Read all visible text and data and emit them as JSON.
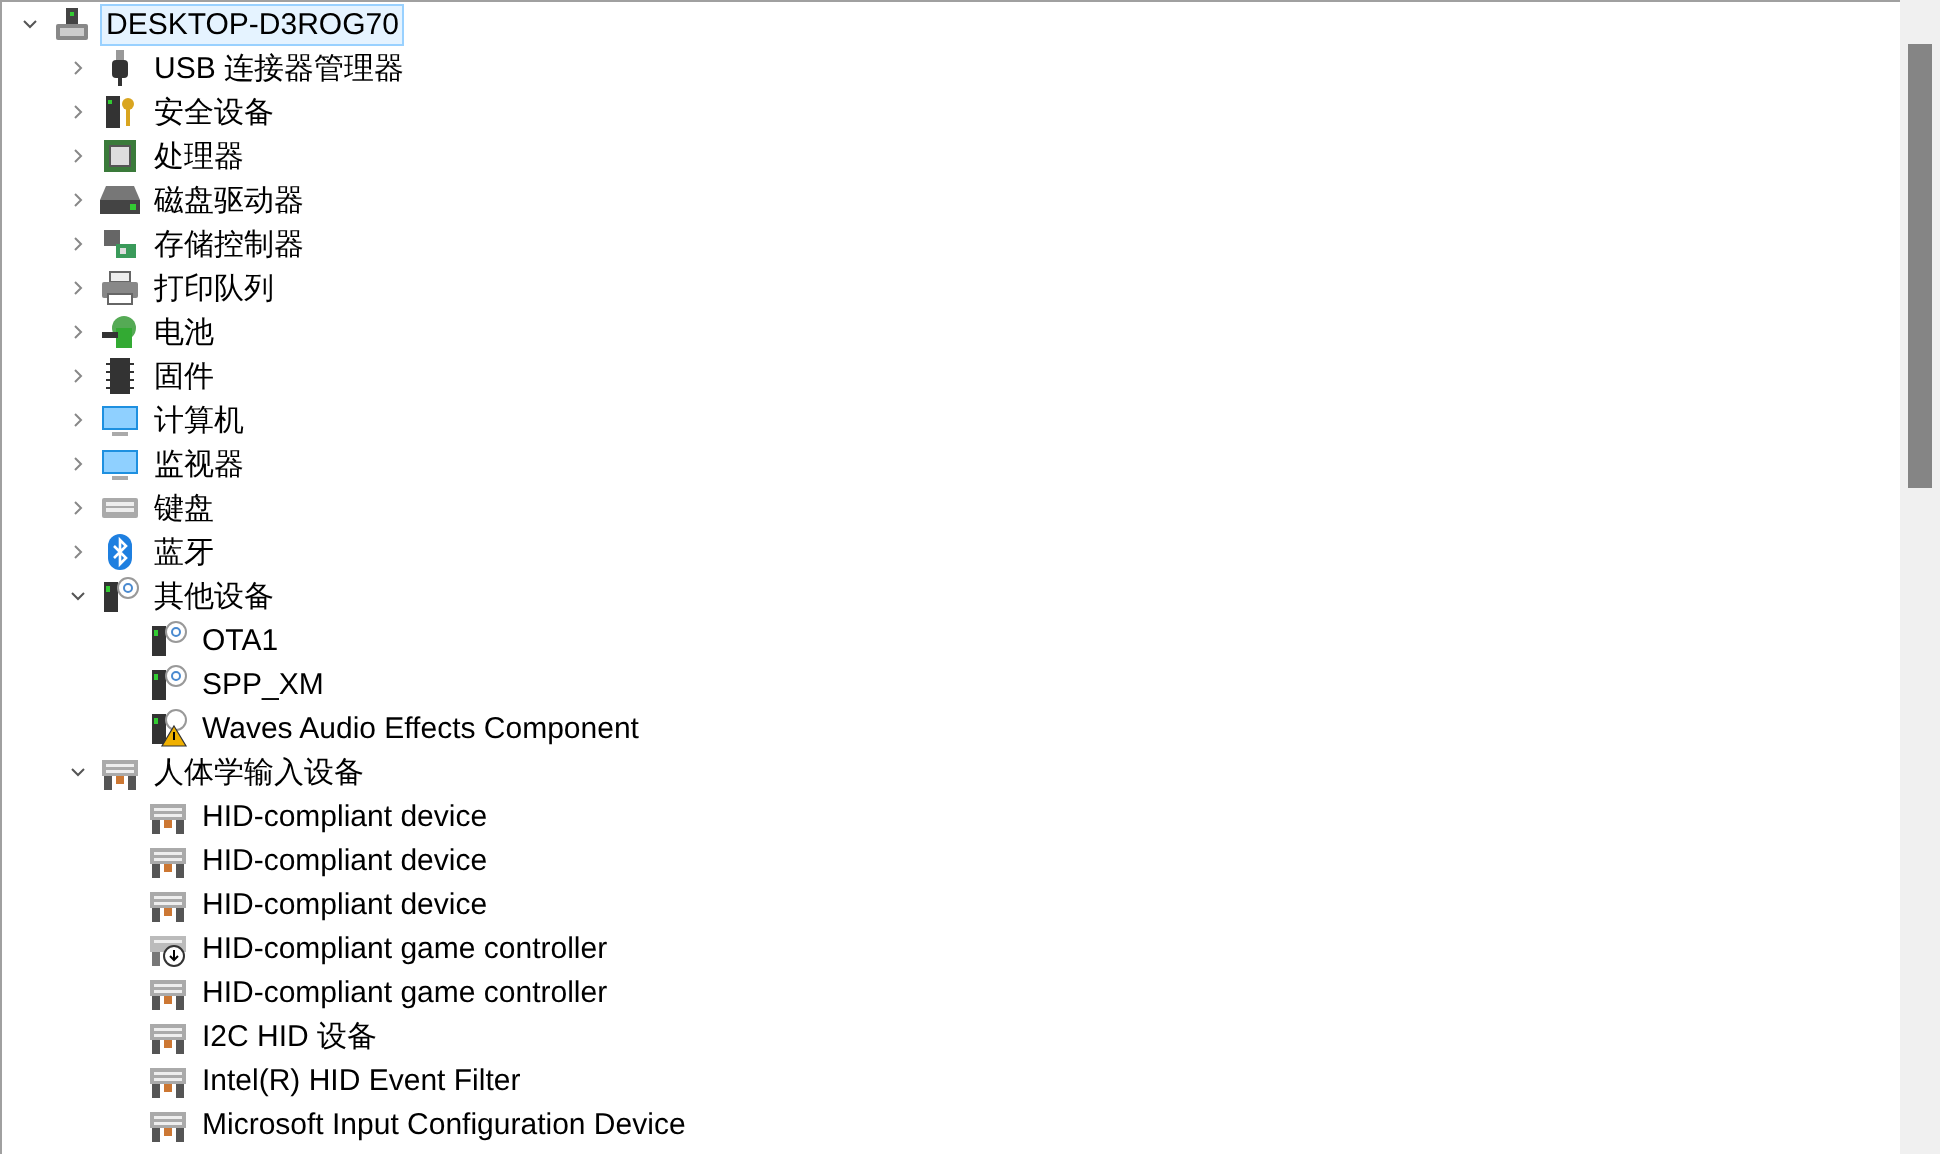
{
  "tree": {
    "label": "DESKTOP-D3ROG70",
    "kind": "computer",
    "selected": true,
    "expanded": true,
    "children": [
      {
        "label": "USB 连接器管理器",
        "kind": "usb",
        "selected": false,
        "expanded": false
      },
      {
        "label": "安全设备",
        "kind": "security",
        "selected": false,
        "expanded": false
      },
      {
        "label": "处理器",
        "kind": "cpu",
        "selected": false,
        "expanded": false
      },
      {
        "label": "磁盘驱动器",
        "kind": "disk",
        "selected": false,
        "expanded": false
      },
      {
        "label": "存储控制器",
        "kind": "storage",
        "selected": false,
        "expanded": false
      },
      {
        "label": "打印队列",
        "kind": "printer",
        "selected": false,
        "expanded": false
      },
      {
        "label": "电池",
        "kind": "battery",
        "selected": false,
        "expanded": false
      },
      {
        "label": "固件",
        "kind": "firmware",
        "selected": false,
        "expanded": false
      },
      {
        "label": "计算机",
        "kind": "monitor",
        "selected": false,
        "expanded": false
      },
      {
        "label": "监视器",
        "kind": "monitor",
        "selected": false,
        "expanded": false
      },
      {
        "label": "键盘",
        "kind": "keyboard",
        "selected": false,
        "expanded": false
      },
      {
        "label": "蓝牙",
        "kind": "bluetooth",
        "selected": false,
        "expanded": false
      },
      {
        "label": "其他设备",
        "kind": "unknown",
        "selected": false,
        "expanded": true,
        "children": [
          {
            "label": "OTA1",
            "kind": "unknown",
            "selected": false
          },
          {
            "label": "SPP_XM",
            "kind": "unknown",
            "selected": false
          },
          {
            "label": "Waves Audio Effects Component",
            "kind": "warning",
            "selected": false
          }
        ]
      },
      {
        "label": "人体学输入设备",
        "kind": "hid",
        "selected": false,
        "expanded": true,
        "children": [
          {
            "label": "HID-compliant device",
            "kind": "hid",
            "selected": false
          },
          {
            "label": "HID-compliant device",
            "kind": "hid",
            "selected": false
          },
          {
            "label": "HID-compliant device",
            "kind": "hid",
            "selected": false
          },
          {
            "label": "HID-compliant game controller",
            "kind": "hid-disabled",
            "selected": false
          },
          {
            "label": "HID-compliant game controller",
            "kind": "hid",
            "selected": false
          },
          {
            "label": "I2C HID 设备",
            "kind": "hid",
            "selected": false
          },
          {
            "label": "Intel(R) HID Event Filter",
            "kind": "hid",
            "selected": false
          },
          {
            "label": "Microsoft Input Configuration Device",
            "kind": "hid",
            "selected": false
          }
        ]
      }
    ]
  }
}
